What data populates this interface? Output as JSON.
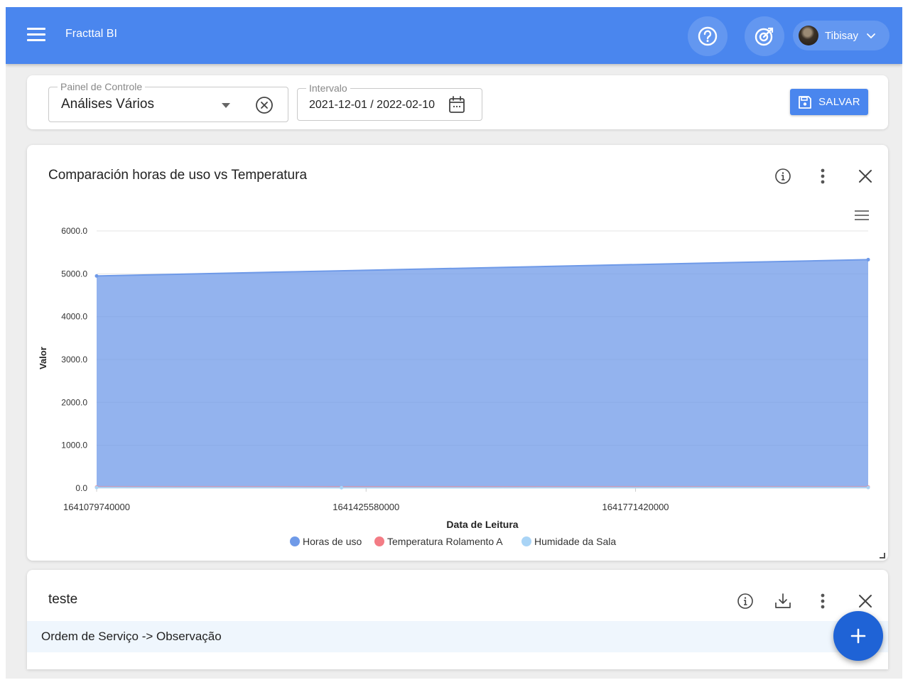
{
  "header": {
    "app_title": "Fracttal BI",
    "user_name": "Tibisay",
    "icons": [
      "menu-icon",
      "help-icon",
      "target-icon",
      "chevron-down-icon"
    ]
  },
  "filters": {
    "dashboard_label": "Painel de Controle",
    "dashboard_value": "Análises Vários",
    "interval_label": "Intervalo",
    "interval_value": "2021-12-01 / 2022-02-10",
    "save_label": "SALVAR"
  },
  "chart_card": {
    "title": "Comparación horas de uso vs Temperatura"
  },
  "chart_data": {
    "type": "area",
    "title": "",
    "xlabel": "Data de Leitura",
    "ylabel": "Valor",
    "ylim": [
      0,
      6000
    ],
    "xlim": [
      1641079740000,
      1642070000000
    ],
    "y_ticks": [
      "0.0",
      "1000.0",
      "2000.0",
      "3000.0",
      "4000.0",
      "5000.0",
      "6000.0"
    ],
    "x_ticks": [
      1641079740000,
      1641425580000,
      1641771420000
    ],
    "x_tick_labels": [
      "1641079740000",
      "1641425580000",
      "1641771420000"
    ],
    "legend_position": "bottom",
    "series": [
      {
        "name": "Horas de uso",
        "color": "#6f9ae8",
        "x": [
          1641079740000,
          1642070000000
        ],
        "y": [
          4950,
          5330
        ]
      },
      {
        "name": "Temperatura Rolamento A",
        "color": "#f37c85",
        "x": [
          1641079740000,
          1642070000000
        ],
        "y": [
          25,
          25
        ]
      },
      {
        "name": "Humidade da Sala",
        "color": "#a9d4f6",
        "x": [
          1641079740000,
          1641394000000,
          1642070000000
        ],
        "y": [
          15,
          10,
          15
        ]
      }
    ]
  },
  "table_card": {
    "title": "teste",
    "row_text": "Ordem de Serviço -> Observação"
  }
}
